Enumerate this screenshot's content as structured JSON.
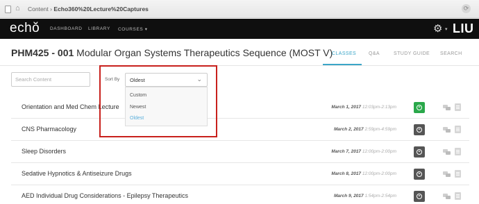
{
  "browser": {
    "breadcrumb_root": "Content",
    "breadcrumb_sep": "›",
    "breadcrumb_current": "Echo360%20Lecture%20Captures"
  },
  "nav": {
    "logo": "echŏ",
    "links": [
      "DASHBOARD",
      "LIBRARY",
      "COURSES ▾"
    ],
    "brand": "LIU"
  },
  "course": {
    "code": "PHM425 - 001",
    "name": "Modular Organ Systems Therapeutics Sequence (MOST V)"
  },
  "tabs": [
    {
      "label": "CLASSES",
      "active": true
    },
    {
      "label": "Q&A",
      "active": false
    },
    {
      "label": "STUDY GUIDE",
      "active": false
    },
    {
      "label": "SEARCH",
      "active": false
    }
  ],
  "search": {
    "placeholder": "Search Content"
  },
  "sort": {
    "label": "Sort By",
    "selected": "Oldest",
    "options": [
      "Custom",
      "Newest",
      "Oldest"
    ]
  },
  "classes": [
    {
      "title": "Orientation and Med Chem Lecture",
      "date": "March 1, 2017",
      "time": "12:03pm-2:13pm",
      "recording": "live"
    },
    {
      "title": "CNS Pharmacology",
      "date": "March 2, 2017",
      "time": "2:59pm-4:59pm",
      "recording": "default"
    },
    {
      "title": "Sleep Disorders",
      "date": "March 7, 2017",
      "time": "12:00pm-2:00pm",
      "recording": "default"
    },
    {
      "title": "Sedative Hypnotics & Antiseizure Drugs",
      "date": "March 8, 2017",
      "time": "12:00pm-2:00pm",
      "recording": "default"
    },
    {
      "title": "AED Individual Drug Considerations - Epilepsy Therapeutics",
      "date": "March 9, 2017",
      "time": "1:54pm-2:54pm",
      "recording": "default"
    }
  ],
  "colors": {
    "accent": "#3ba6c8",
    "live_green": "#2aa84a",
    "highlight_red": "#c8201c",
    "nav_bg": "#0f0f0f"
  },
  "icons": [
    "page-icon",
    "home-icon",
    "reload-icon",
    "gear-icon",
    "chevron-down-icon",
    "play-icon",
    "chat-icon",
    "document-icon"
  ]
}
